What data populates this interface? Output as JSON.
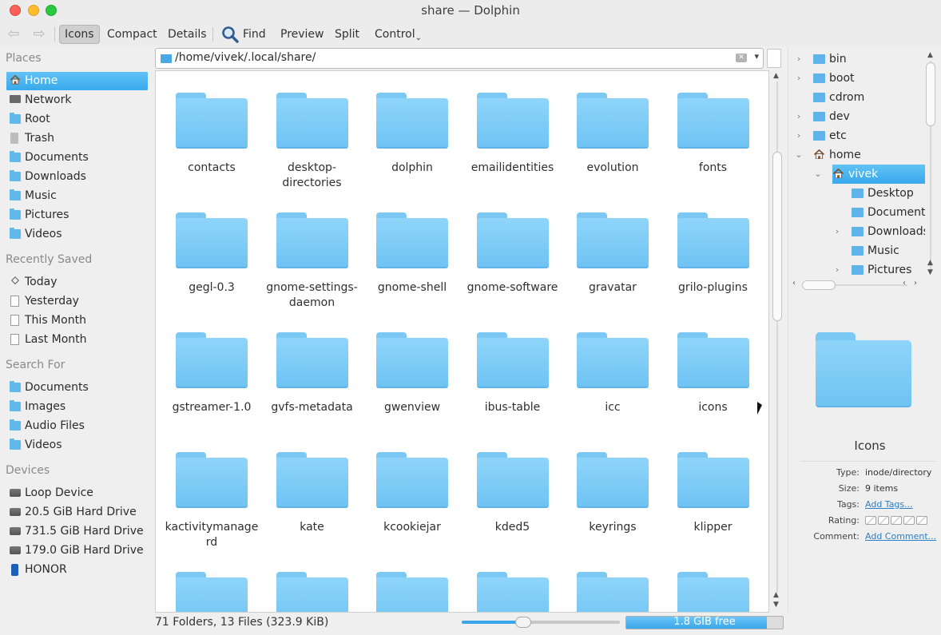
{
  "window": {
    "title": "share — Dolphin"
  },
  "toolbar": {
    "back_label": "⇦",
    "forward_label": "⇨",
    "icons": "Icons",
    "compact": "Compact",
    "details": "Details",
    "find": "Find",
    "preview": "Preview",
    "split": "Split",
    "control": "Control"
  },
  "sidebar": {
    "places_title": "Places",
    "places": [
      {
        "label": "Home",
        "icon": "home-icon",
        "selected": true
      },
      {
        "label": "Network",
        "icon": "network-icon"
      },
      {
        "label": "Root",
        "icon": "folder-icon"
      },
      {
        "label": "Trash",
        "icon": "trash-icon"
      },
      {
        "label": "Documents",
        "icon": "folder-icon"
      },
      {
        "label": "Downloads",
        "icon": "folder-icon"
      },
      {
        "label": "Music",
        "icon": "folder-icon"
      },
      {
        "label": "Pictures",
        "icon": "folder-icon"
      },
      {
        "label": "Videos",
        "icon": "folder-icon"
      }
    ],
    "recent_title": "Recently Saved",
    "recent": [
      {
        "label": "Today",
        "icon": "calendar-icon"
      },
      {
        "label": "Yesterday",
        "icon": "document-icon"
      },
      {
        "label": "This Month",
        "icon": "document-icon"
      },
      {
        "label": "Last Month",
        "icon": "document-icon"
      }
    ],
    "search_title": "Search For",
    "search": [
      {
        "label": "Documents",
        "icon": "folder-icon"
      },
      {
        "label": "Images",
        "icon": "folder-icon"
      },
      {
        "label": "Audio Files",
        "icon": "folder-icon"
      },
      {
        "label": "Videos",
        "icon": "folder-icon"
      }
    ],
    "devices_title": "Devices",
    "devices": [
      {
        "label": "Loop Device",
        "icon": "drive-icon"
      },
      {
        "label": "20.5 GiB Hard Drive",
        "icon": "drive-icon"
      },
      {
        "label": "731.5 GiB Hard Drive",
        "icon": "drive-icon"
      },
      {
        "label": "179.0 GiB Hard Drive",
        "icon": "drive-icon"
      },
      {
        "label": "HONOR",
        "icon": "phone-icon"
      }
    ]
  },
  "location": {
    "path": "/home/vivek/.local/share/"
  },
  "files": [
    "contacts",
    "desktop-directories",
    "dolphin",
    "emailidentities",
    "evolution",
    "fonts",
    "gegl-0.3",
    "gnome-settings-daemon",
    "gnome-shell",
    "gnome-software",
    "gravatar",
    "grilo-plugins",
    "gstreamer-1.0",
    "gvfs-metadata",
    "gwenview",
    "ibus-table",
    "icc",
    "icons",
    "kactivitymanagerd",
    "kate",
    "kcookiejar",
    "kded5",
    "keyrings",
    "klipper",
    "",
    "",
    "",
    "",
    "",
    ""
  ],
  "status": {
    "summary": "71 Folders, 13 Files (323.9 KiB)",
    "zoom_fraction": 0.38,
    "free_label": "1.8 GIB free",
    "used_fraction": 0.9
  },
  "tree": [
    {
      "label": "bin",
      "depth": 0,
      "expander": "›",
      "icon": "folder-icon"
    },
    {
      "label": "boot",
      "depth": 0,
      "expander": "›",
      "icon": "folder-icon"
    },
    {
      "label": "cdrom",
      "depth": 0,
      "expander": "",
      "icon": "folder-icon"
    },
    {
      "label": "dev",
      "depth": 0,
      "expander": "›",
      "icon": "folder-icon"
    },
    {
      "label": "etc",
      "depth": 0,
      "expander": "›",
      "icon": "folder-icon"
    },
    {
      "label": "home",
      "depth": 0,
      "expander": "⌄",
      "icon": "home-icon"
    },
    {
      "label": "vivek",
      "depth": 1,
      "expander": "⌄",
      "icon": "home-icon",
      "selected": true
    },
    {
      "label": "Desktop",
      "depth": 2,
      "expander": "",
      "icon": "folder-icon"
    },
    {
      "label": "Document",
      "depth": 2,
      "expander": "",
      "icon": "folder-icon"
    },
    {
      "label": "Downloads",
      "depth": 2,
      "expander": "›",
      "icon": "folder-icon"
    },
    {
      "label": "Music",
      "depth": 2,
      "expander": "",
      "icon": "folder-icon"
    },
    {
      "label": "Pictures",
      "depth": 2,
      "expander": "›",
      "icon": "folder-icon"
    }
  ],
  "info": {
    "name": "Icons",
    "type_key": "Type:",
    "type_val": "inode/directory",
    "size_key": "Size:",
    "size_val": "9 items",
    "tags_key": "Tags:",
    "tags_val": "Add Tags...",
    "rating_key": "Rating:",
    "rating_stars": 0,
    "comment_key": "Comment:",
    "comment_val": "Add Comment..."
  },
  "colors": {
    "accent": "#3aa6e9",
    "folder": "#7cc8f4",
    "selection": "#38a8ec"
  }
}
